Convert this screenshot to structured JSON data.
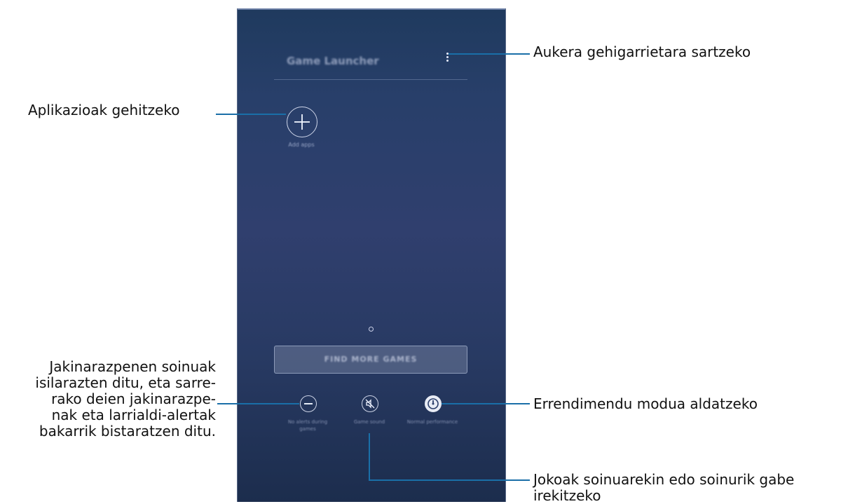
{
  "screen": {
    "app_title": "Game Launcher",
    "add_apps_label": "Add apps",
    "find_more_button": "FIND MORE GAMES",
    "quick_settings": [
      {
        "icon": "do-not-disturb-icon",
        "label": "No alerts during games"
      },
      {
        "icon": "mute-icon",
        "label": "Game sound"
      },
      {
        "icon": "performance-icon",
        "label": "Normal performance"
      }
    ]
  },
  "callouts": {
    "more_options": "Aukera gehigarrietara sartzeko",
    "add_apps": "Aplikazioak gehitzeko",
    "notifications": [
      "Jakinarazpenen soinuak",
      "isilarazten ditu, eta sarre-",
      "rako deien jakinarazpe-",
      "nak eta larrialdi-alertak",
      "bakarrik bistaratzen ditu."
    ],
    "performance": "Errendimendu modua aldatzeko",
    "sound": [
      "Jokoak soinuarekin edo soinurik gabe",
      "irekitzeko"
    ]
  },
  "colors": {
    "callout_line": "#1a6fa8",
    "screen_bg": "#2b3e6a"
  }
}
